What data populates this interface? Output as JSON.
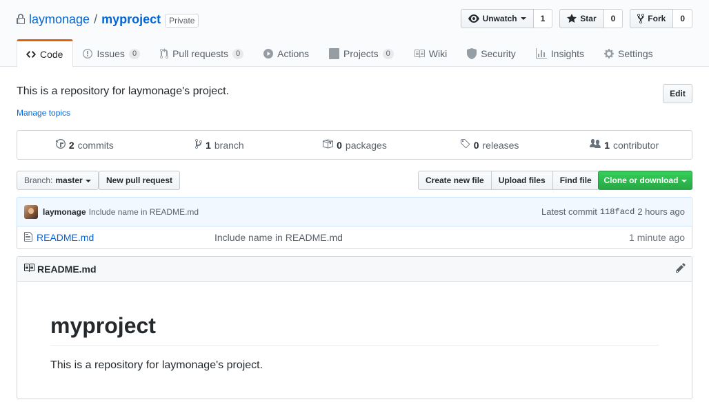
{
  "repo": {
    "owner": "laymonage",
    "separator": "/",
    "name": "myproject",
    "visibility": "Private",
    "description": "This is a repository for laymonage's project.",
    "manage_topics": "Manage topics",
    "edit_label": "Edit"
  },
  "actions": {
    "watch_label": "Unwatch",
    "watch_count": "1",
    "star_label": "Star",
    "star_count": "0",
    "fork_label": "Fork",
    "fork_count": "0"
  },
  "tabs": [
    {
      "label": "Code",
      "icon": "code-icon",
      "selected": true
    },
    {
      "label": "Issues",
      "count": "0",
      "icon": "issue-icon"
    },
    {
      "label": "Pull requests",
      "count": "0",
      "icon": "pull-request-icon"
    },
    {
      "label": "Actions",
      "icon": "play-icon"
    },
    {
      "label": "Projects",
      "count": "0",
      "icon": "project-icon"
    },
    {
      "label": "Wiki",
      "icon": "book-icon"
    },
    {
      "label": "Security",
      "icon": "shield-icon"
    },
    {
      "label": "Insights",
      "icon": "graph-icon"
    },
    {
      "label": "Settings",
      "icon": "gear-icon"
    }
  ],
  "summary": [
    {
      "count": "2",
      "label": "commits",
      "icon": "history-icon"
    },
    {
      "count": "1",
      "label": "branch",
      "icon": "branch-icon"
    },
    {
      "count": "0",
      "label": "packages",
      "icon": "package-icon"
    },
    {
      "count": "0",
      "label": "releases",
      "icon": "tag-icon"
    },
    {
      "count": "1",
      "label": "contributor",
      "icon": "people-icon"
    }
  ],
  "file_nav": {
    "branch_prefix": "Branch:",
    "branch_name": "master",
    "new_pr": "New pull request",
    "create_file": "Create new file",
    "upload_files": "Upload files",
    "find_file": "Find file",
    "clone": "Clone or download"
  },
  "latest_commit": {
    "author": "laymonage",
    "message": "Include name in README.md",
    "prefix": "Latest commit",
    "sha": "118facd",
    "age": "2 hours ago"
  },
  "files": [
    {
      "name": "README.md",
      "message": "Include name in README.md",
      "age": "1 minute ago",
      "icon": "file-icon"
    }
  ],
  "readme": {
    "filename": "README.md",
    "heading": "myproject",
    "paragraph": "This is a repository for laymonage's project."
  },
  "colors": {
    "accent_link": "#0366d6",
    "tab_active_border": "#e36209",
    "clone_green": "#28a745"
  }
}
